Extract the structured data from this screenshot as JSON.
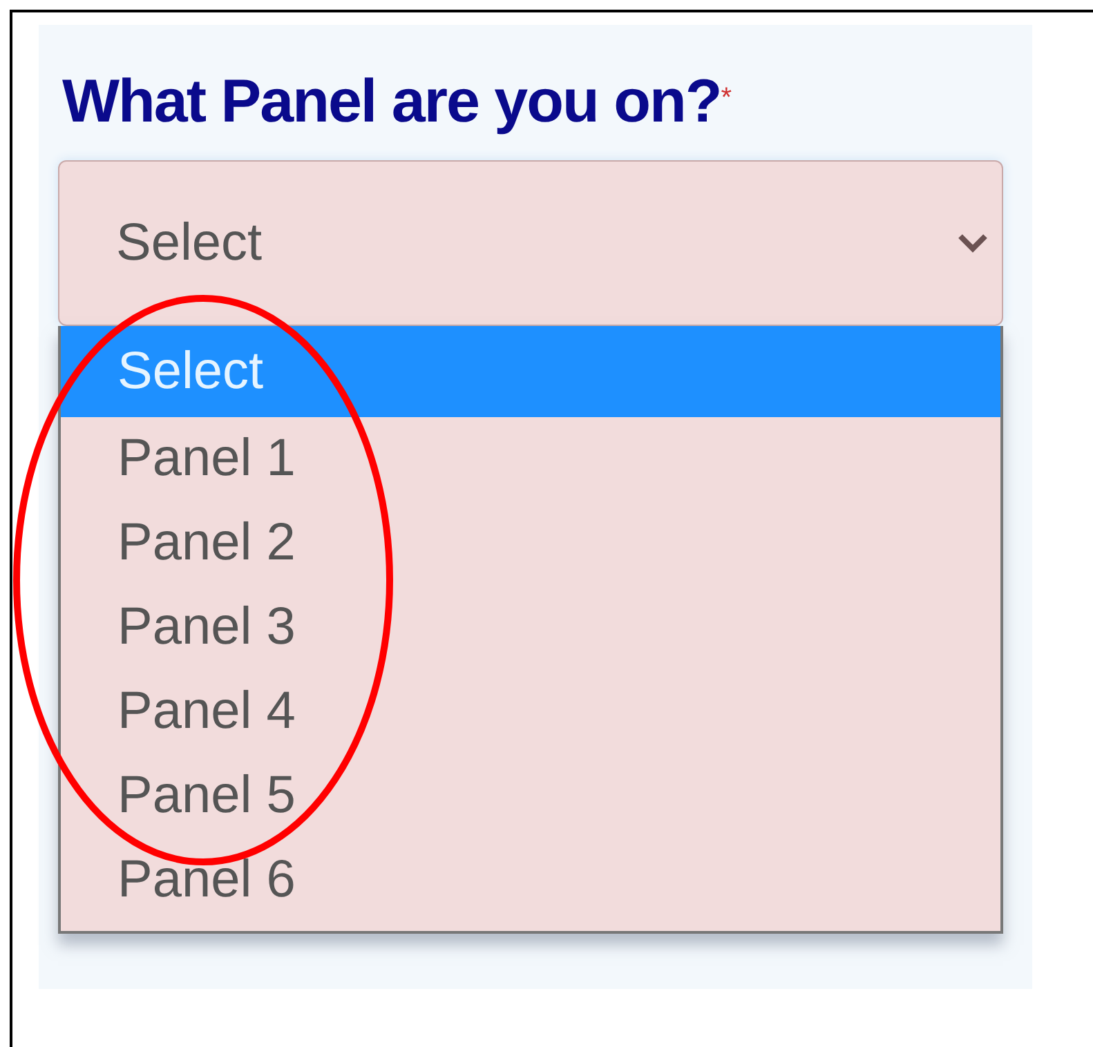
{
  "question": {
    "label": "What Panel are you on?",
    "required_mark": "*"
  },
  "select": {
    "value": "Select"
  },
  "options": [
    {
      "label": "Select",
      "selected": true
    },
    {
      "label": "Panel 1",
      "selected": false
    },
    {
      "label": "Panel 2",
      "selected": false
    },
    {
      "label": "Panel 3",
      "selected": false
    },
    {
      "label": "Panel 4",
      "selected": false
    },
    {
      "label": "Panel 5",
      "selected": false
    },
    {
      "label": "Panel 6",
      "selected": false
    }
  ]
}
